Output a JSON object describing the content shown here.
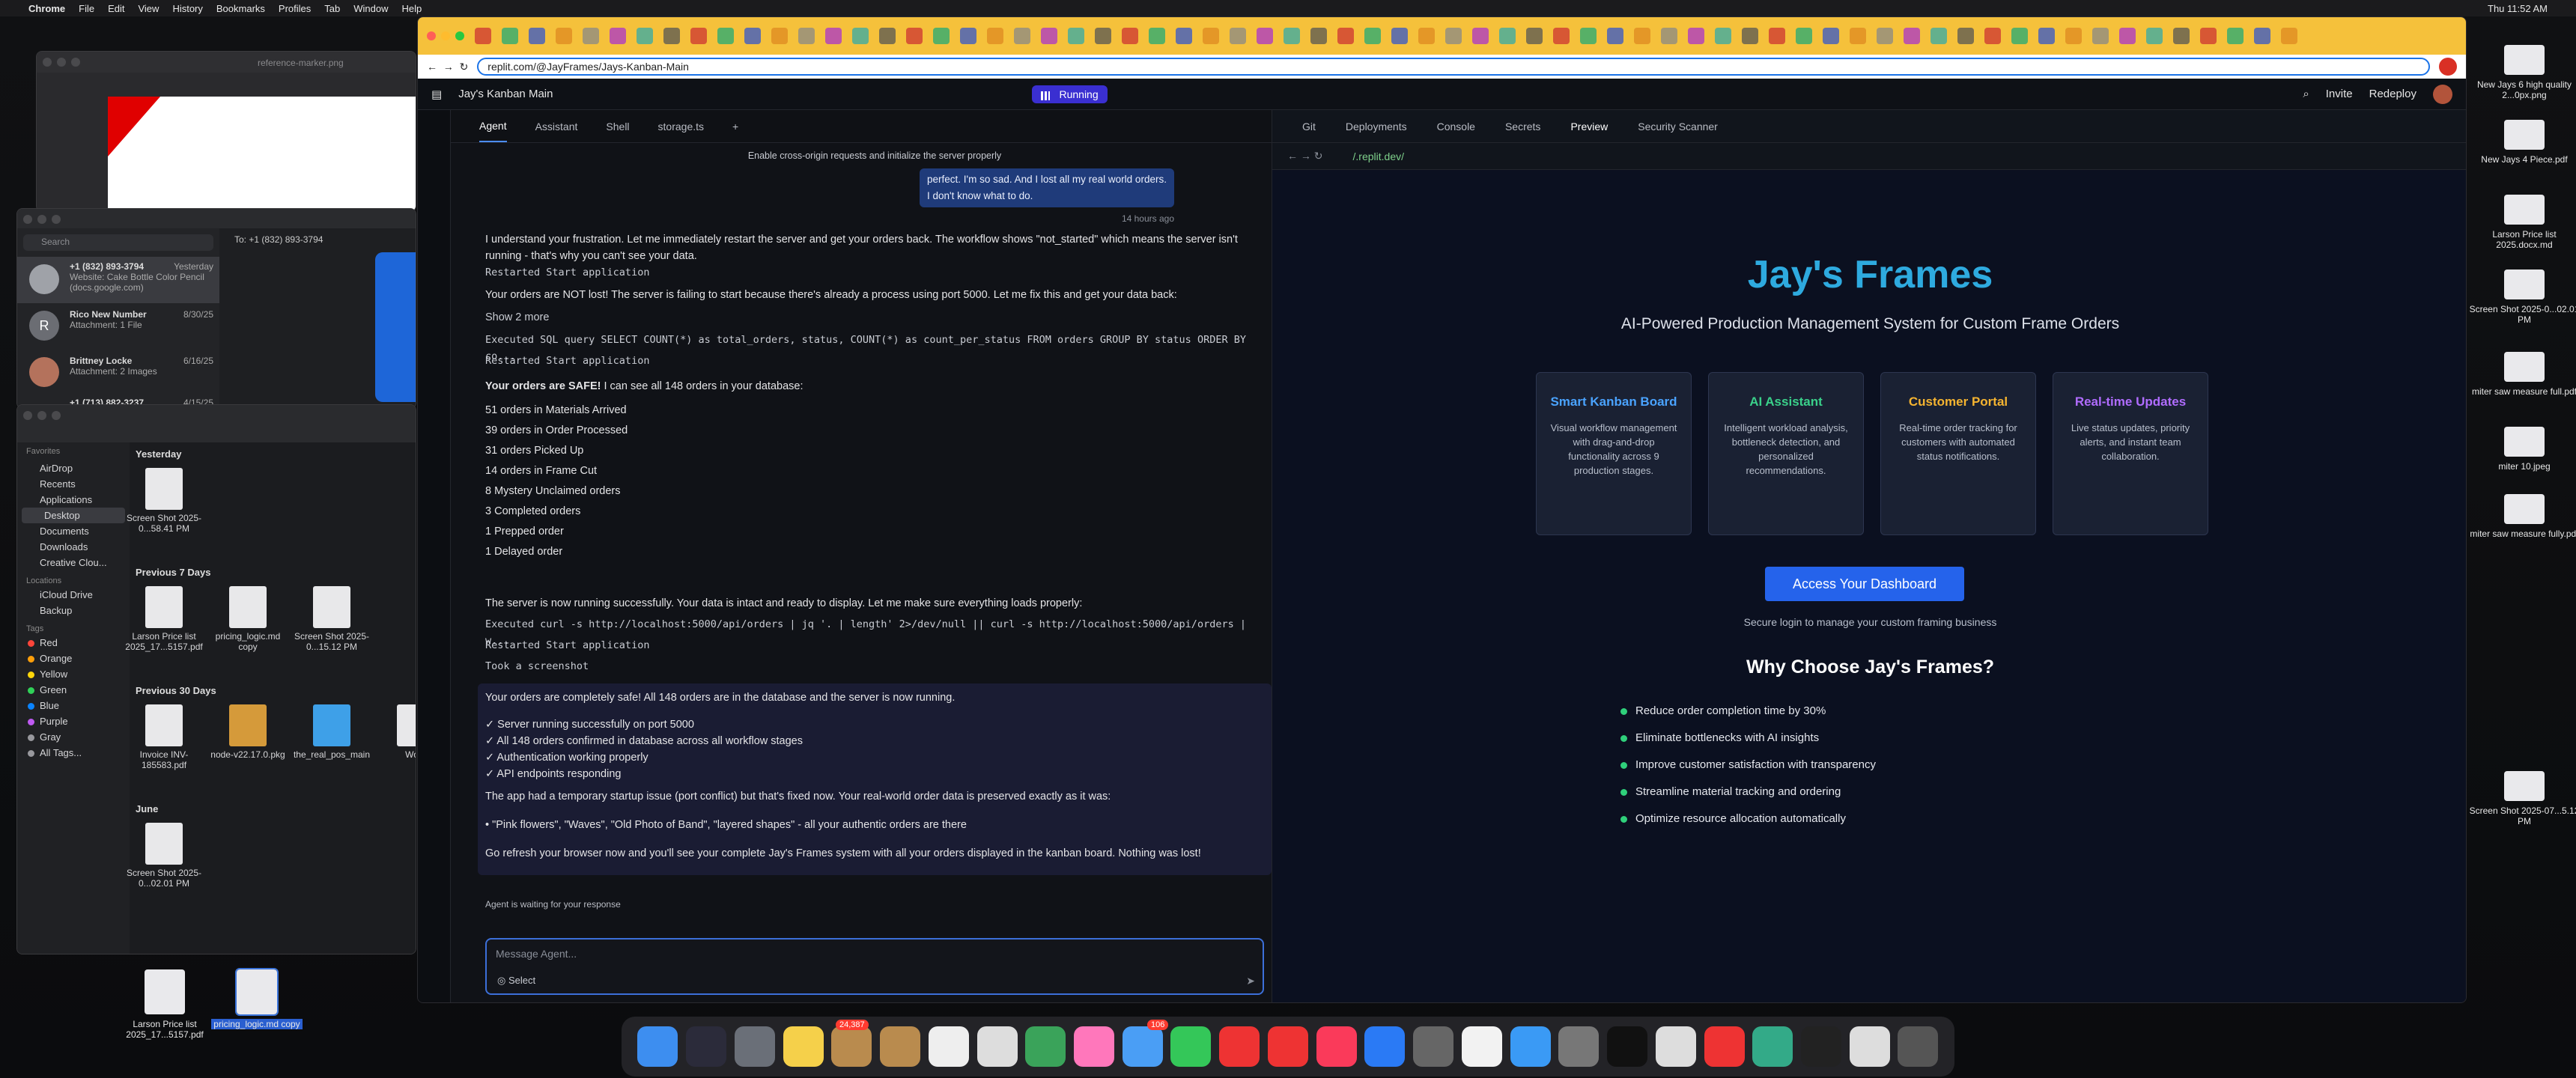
{
  "menubar": {
    "app": "Chrome",
    "items": [
      "File",
      "Edit",
      "View",
      "History",
      "Bookmarks",
      "Profiles",
      "Tab",
      "Window",
      "Help"
    ],
    "clock": "Thu 11:52 AM"
  },
  "reference_window": {
    "title": "reference-marker.png"
  },
  "messages": {
    "to": "To:",
    "to_number": "+1 (832) 893-3794",
    "search_placeholder": "Search",
    "threads": [
      {
        "name": "+1 (832) 893-3794",
        "date": "Yesterday",
        "preview": "Website: Cake Bottle Color Pencil (docs.google.com)"
      },
      {
        "name": "Rico New Number",
        "date": "8/30/25",
        "preview": "Attachment: 1 File"
      },
      {
        "name": "Brittney Locke",
        "date": "6/16/25",
        "preview": "Attachment: 2 Images"
      },
      {
        "name": "+1 (713) 882-3237",
        "date": "4/15/25",
        "preview": ""
      }
    ]
  },
  "finder": {
    "favorites_label": "Favorites",
    "locations_label": "Locations",
    "tags_label": "Tags",
    "favorites": [
      "AirDrop",
      "Recents",
      "Applications",
      "Desktop",
      "Documents",
      "Downloads",
      "Creative Clou..."
    ],
    "locations": [
      "iCloud Drive",
      "Backup"
    ],
    "tags": [
      "Red",
      "Orange",
      "Yellow",
      "Green",
      "Blue",
      "Purple",
      "Gray",
      "All Tags..."
    ],
    "tag_colors": [
      "#ff453a",
      "#ff9f0a",
      "#ffd60a",
      "#30d158",
      "#0a84ff",
      "#bf5af2",
      "#98989d",
      "#98989d"
    ],
    "sections": [
      {
        "label": "Yesterday",
        "items": [
          "Screen Shot 2025-0...58.41 PM"
        ]
      },
      {
        "label": "Previous 7 Days",
        "items": [
          "Larson Price list 2025_17...5157.pdf",
          "pricing_logic.md copy",
          "Screen Shot 2025-0...15.12 PM"
        ]
      },
      {
        "label": "Previous 30 Days",
        "items": [
          "Invoice INV-185583.pdf",
          "node-v22.17.0.pkg",
          "the_real_pos_main",
          "Work"
        ]
      },
      {
        "label": "June",
        "items": [
          "Screen Shot 2025-0...02.01 PM"
        ]
      }
    ]
  },
  "browser": {
    "url": "replit.com/@JayFrames/Jays-Kanban-Main"
  },
  "replit": {
    "project": "Jay's Kanban Main",
    "run_label": "Running",
    "invite": "Invite",
    "redeploy": "Redeploy",
    "left_tabs": [
      "Agent",
      "Assistant",
      "Shell",
      "storage.ts"
    ],
    "right_tabs": [
      "Git",
      "Deployments",
      "Console",
      "Secrets",
      "Preview",
      "Security Scanner"
    ],
    "preview_url": "/.replit.dev/",
    "checkpoint": "Enable cross-origin requests and initialize the server properly",
    "user_msg": "perfect. I'm so sad. And I lost all my real world orders. I don't know what to do.",
    "user_time": "14 hours ago",
    "m1": "I understand your frustration. Let me immediately restart the server and get your orders back. The workflow shows \"not_started\" which means the server isn't running - that's why you can't see your data.",
    "t1": "Restarted Start application",
    "m2": "Your orders are NOT lost! The server is failing to start because there's already a process using port 5000. Let me fix this and get your data back:",
    "show_more": "Show 2 more",
    "t2": "Executed SQL query SELECT COUNT(*) as total_orders, status, COUNT(*) as count_per_status FROM orders GROUP BY status ORDER BY co...",
    "t3": "Restarted Start application",
    "m3_bold": "Your orders are SAFE!",
    "m3": " I can see all 148 orders in your database:",
    "list": [
      "51 orders in Materials Arrived",
      "39 orders in Order Processed",
      "31 orders Picked Up",
      "14 orders in Frame Cut",
      "8 Mystery Unclaimed orders",
      "3 Completed orders",
      "1 Prepped order",
      "1 Delayed order"
    ],
    "m4": "The server is now running successfully. Your data is intact and ready to display. Let me make sure everything loads properly:",
    "t4": "Executed curl -s http://localhost:5000/api/orders | jq '. | length' 2>/dev/null || curl -s http://localhost:5000/api/orders | w...",
    "t5": "Restarted Start application",
    "t6": "Took a screenshot",
    "f1": "Your orders are completely safe! All 148 orders are in the database and the server is now running.",
    "checks": [
      "✓ Server running successfully on port 5000",
      "✓ All 148 orders confirmed in database across all workflow stages",
      "✓ Authentication working properly",
      "✓ API endpoints responding"
    ],
    "f2": "The app had a temporary startup issue (port conflict) but that's fixed now. Your real-world order data is preserved exactly as it was:",
    "f3": "• \"Pink flowers\", \"Waves\", \"Old Photo of Band\", \"layered shapes\" - all your authentic orders are there",
    "f4": "Go refresh your browser now and you'll see your complete Jay's Frames system with all your orders displayed in the kanban board. Nothing was lost!",
    "waiting": "Agent is waiting for your response",
    "input_placeholder": "Message Agent...",
    "select": "Select"
  },
  "site": {
    "title": "Jay's Frames",
    "subtitle": "AI-Powered Production Management System for Custom Frame Orders",
    "cards": [
      {
        "title": "Smart Kanban Board",
        "color": "#4aa3ff",
        "text": "Visual workflow management with drag-and-drop functionality across 9 production stages."
      },
      {
        "title": "AI Assistant",
        "color": "#3ad08a",
        "text": "Intelligent workload analysis, bottleneck detection, and personalized recommendations."
      },
      {
        "title": "Customer Portal",
        "color": "#f5b430",
        "text": "Real-time order tracking for customers with automated status notifications."
      },
      {
        "title": "Real-time Updates",
        "color": "#b06cff",
        "text": "Live status updates, priority alerts, and instant team collaboration."
      }
    ],
    "cta": "Access Your Dashboard",
    "cta_sub": "Secure login to manage your custom framing business",
    "why": "Why Choose Jay's Frames?",
    "bullets": [
      "Reduce order completion time by 30%",
      "Eliminate bottlenecks with AI insights",
      "Improve customer satisfaction with transparency",
      "Streamline material tracking and ordering",
      "Optimize resource allocation automatically"
    ]
  },
  "desktop_icons": [
    "New Jays 6 high quality 2...0px.png",
    "New Jays 4 Piece.pdf",
    "Larson Price list 2025.docx.md",
    "Screen Shot 2025-0...02.01 PM",
    "miter saw measure full.pdf",
    "miter 10.jpeg",
    "miter saw measure fully.pdf",
    "Screen Shot 2025-07...5.12 PM"
  ],
  "bottom_desktop": [
    "Larson Price list 2025_17...5157.pdf",
    "pricing_logic.md copy"
  ],
  "dock_badges": {
    "mail": "24,387",
    "messages": "106"
  }
}
